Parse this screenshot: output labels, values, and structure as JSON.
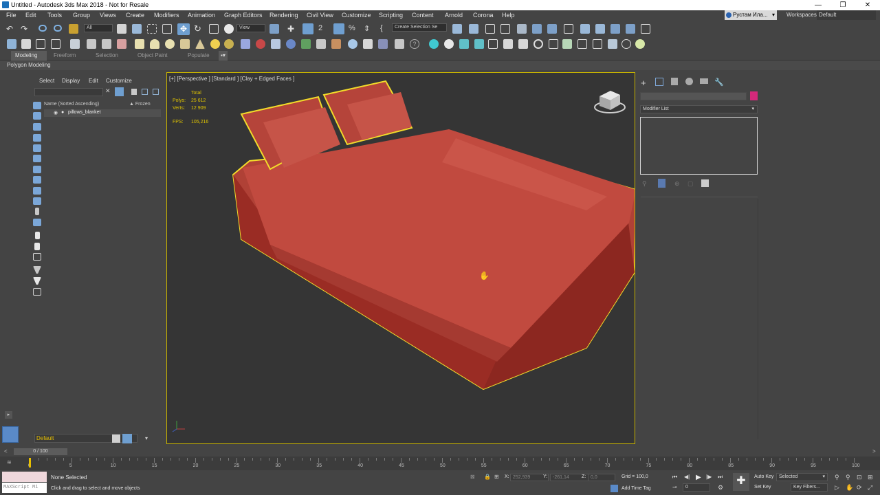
{
  "window": {
    "title": "Untitled - Autodesk 3ds Max 2018 - Not for Resale"
  },
  "menu": [
    "File",
    "Edit",
    "Tools",
    "Group",
    "Views",
    "Create",
    "Modifiers",
    "Animation",
    "Graph Editors",
    "Rendering",
    "Civil View",
    "Customize",
    "Scripting",
    "Content",
    "Arnold",
    "Corona",
    "Help"
  ],
  "user": {
    "name": "Рустам Ила..."
  },
  "workspace": {
    "label": "Workspaces:",
    "value": "Default"
  },
  "toolbar": {
    "filter": "All",
    "refcoord": "View",
    "selection_set": "Create Selection Se"
  },
  "ribbon": {
    "tabs": [
      "Modeling",
      "Freeform",
      "Selection",
      "Object Paint",
      "Populate"
    ],
    "active": "Modeling",
    "panel": "Polygon Modeling"
  },
  "scene_explorer": {
    "tabs": [
      "Select",
      "Display",
      "Edit",
      "Customize"
    ],
    "col_name": "Name (Sorted Ascending)",
    "col_frozen": "▲ Frozen",
    "items": [
      "pillows_blanket"
    ],
    "layer": "Default"
  },
  "viewport": {
    "label": "[+] [Perspective ] [Standard ] [Clay + Edged Faces ]",
    "stats": {
      "header": "Total",
      "polys_label": "Polys:",
      "polys": "25 612",
      "verts_label": "Verts:",
      "verts": "12 909",
      "fps_label": "FPS:",
      "fps": "105,216"
    }
  },
  "command_panel": {
    "modifier_list": "Modifier List"
  },
  "time_slider": {
    "value": "0 / 100"
  },
  "track_ticks": [
    "0",
    "5",
    "10",
    "15",
    "20",
    "25",
    "30",
    "35",
    "40",
    "45",
    "50",
    "55",
    "60",
    "65",
    "70",
    "75",
    "80",
    "85",
    "90",
    "95",
    "100"
  ],
  "status": {
    "maxscript": "MAXScript Mi",
    "selection": "None Selected",
    "prompt": "Click and drag to select and move objects",
    "x_label": "X:",
    "x": "252,939",
    "y_label": "Y:",
    "y": "-261,14",
    "z_label": "Z:",
    "z": "0,0",
    "grid": "Grid = 100,0",
    "add_time_tag": "Add Time Tag",
    "auto_key": "Auto Key",
    "set_key": "Set Key",
    "key_mode": "Selected",
    "key_filters": "Key Filters...",
    "frame": "0"
  },
  "colors": {
    "accent": "#d4297a",
    "selection_outline": "#e8d000",
    "object": "#b8453b",
    "stats": "#e0c400"
  }
}
